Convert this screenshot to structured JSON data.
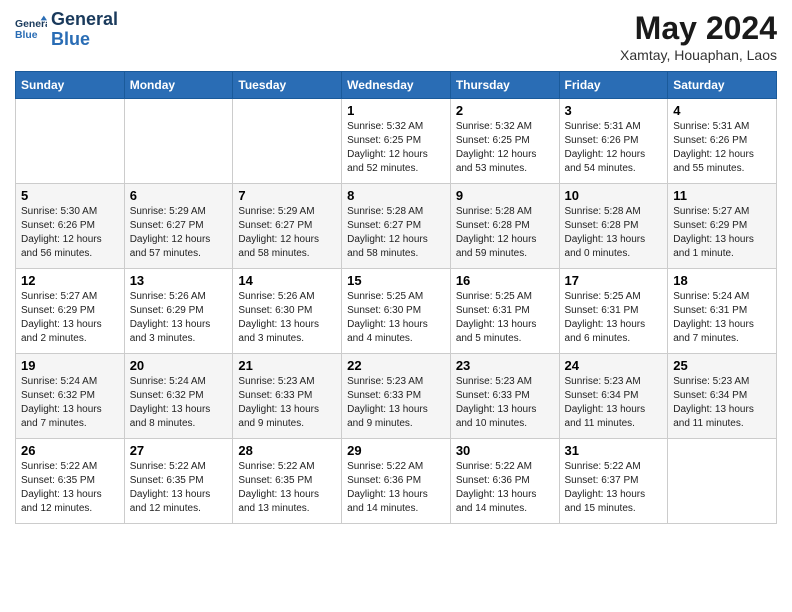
{
  "logo": {
    "line1": "General",
    "line2": "Blue"
  },
  "title": "May 2024",
  "location": "Xamtay, Houaphan, Laos",
  "weekdays": [
    "Sunday",
    "Monday",
    "Tuesday",
    "Wednesday",
    "Thursday",
    "Friday",
    "Saturday"
  ],
  "weeks": [
    [
      {
        "day": "",
        "info": ""
      },
      {
        "day": "",
        "info": ""
      },
      {
        "day": "",
        "info": ""
      },
      {
        "day": "1",
        "info": "Sunrise: 5:32 AM\nSunset: 6:25 PM\nDaylight: 12 hours\nand 52 minutes."
      },
      {
        "day": "2",
        "info": "Sunrise: 5:32 AM\nSunset: 6:25 PM\nDaylight: 12 hours\nand 53 minutes."
      },
      {
        "day": "3",
        "info": "Sunrise: 5:31 AM\nSunset: 6:26 PM\nDaylight: 12 hours\nand 54 minutes."
      },
      {
        "day": "4",
        "info": "Sunrise: 5:31 AM\nSunset: 6:26 PM\nDaylight: 12 hours\nand 55 minutes."
      }
    ],
    [
      {
        "day": "5",
        "info": "Sunrise: 5:30 AM\nSunset: 6:26 PM\nDaylight: 12 hours\nand 56 minutes."
      },
      {
        "day": "6",
        "info": "Sunrise: 5:29 AM\nSunset: 6:27 PM\nDaylight: 12 hours\nand 57 minutes."
      },
      {
        "day": "7",
        "info": "Sunrise: 5:29 AM\nSunset: 6:27 PM\nDaylight: 12 hours\nand 58 minutes."
      },
      {
        "day": "8",
        "info": "Sunrise: 5:28 AM\nSunset: 6:27 PM\nDaylight: 12 hours\nand 58 minutes."
      },
      {
        "day": "9",
        "info": "Sunrise: 5:28 AM\nSunset: 6:28 PM\nDaylight: 12 hours\nand 59 minutes."
      },
      {
        "day": "10",
        "info": "Sunrise: 5:28 AM\nSunset: 6:28 PM\nDaylight: 13 hours\nand 0 minutes."
      },
      {
        "day": "11",
        "info": "Sunrise: 5:27 AM\nSunset: 6:29 PM\nDaylight: 13 hours\nand 1 minute."
      }
    ],
    [
      {
        "day": "12",
        "info": "Sunrise: 5:27 AM\nSunset: 6:29 PM\nDaylight: 13 hours\nand 2 minutes."
      },
      {
        "day": "13",
        "info": "Sunrise: 5:26 AM\nSunset: 6:29 PM\nDaylight: 13 hours\nand 3 minutes."
      },
      {
        "day": "14",
        "info": "Sunrise: 5:26 AM\nSunset: 6:30 PM\nDaylight: 13 hours\nand 3 minutes."
      },
      {
        "day": "15",
        "info": "Sunrise: 5:25 AM\nSunset: 6:30 PM\nDaylight: 13 hours\nand 4 minutes."
      },
      {
        "day": "16",
        "info": "Sunrise: 5:25 AM\nSunset: 6:31 PM\nDaylight: 13 hours\nand 5 minutes."
      },
      {
        "day": "17",
        "info": "Sunrise: 5:25 AM\nSunset: 6:31 PM\nDaylight: 13 hours\nand 6 minutes."
      },
      {
        "day": "18",
        "info": "Sunrise: 5:24 AM\nSunset: 6:31 PM\nDaylight: 13 hours\nand 7 minutes."
      }
    ],
    [
      {
        "day": "19",
        "info": "Sunrise: 5:24 AM\nSunset: 6:32 PM\nDaylight: 13 hours\nand 7 minutes."
      },
      {
        "day": "20",
        "info": "Sunrise: 5:24 AM\nSunset: 6:32 PM\nDaylight: 13 hours\nand 8 minutes."
      },
      {
        "day": "21",
        "info": "Sunrise: 5:23 AM\nSunset: 6:33 PM\nDaylight: 13 hours\nand 9 minutes."
      },
      {
        "day": "22",
        "info": "Sunrise: 5:23 AM\nSunset: 6:33 PM\nDaylight: 13 hours\nand 9 minutes."
      },
      {
        "day": "23",
        "info": "Sunrise: 5:23 AM\nSunset: 6:33 PM\nDaylight: 13 hours\nand 10 minutes."
      },
      {
        "day": "24",
        "info": "Sunrise: 5:23 AM\nSunset: 6:34 PM\nDaylight: 13 hours\nand 11 minutes."
      },
      {
        "day": "25",
        "info": "Sunrise: 5:23 AM\nSunset: 6:34 PM\nDaylight: 13 hours\nand 11 minutes."
      }
    ],
    [
      {
        "day": "26",
        "info": "Sunrise: 5:22 AM\nSunset: 6:35 PM\nDaylight: 13 hours\nand 12 minutes."
      },
      {
        "day": "27",
        "info": "Sunrise: 5:22 AM\nSunset: 6:35 PM\nDaylight: 13 hours\nand 12 minutes."
      },
      {
        "day": "28",
        "info": "Sunrise: 5:22 AM\nSunset: 6:35 PM\nDaylight: 13 hours\nand 13 minutes."
      },
      {
        "day": "29",
        "info": "Sunrise: 5:22 AM\nSunset: 6:36 PM\nDaylight: 13 hours\nand 14 minutes."
      },
      {
        "day": "30",
        "info": "Sunrise: 5:22 AM\nSunset: 6:36 PM\nDaylight: 13 hours\nand 14 minutes."
      },
      {
        "day": "31",
        "info": "Sunrise: 5:22 AM\nSunset: 6:37 PM\nDaylight: 13 hours\nand 15 minutes."
      },
      {
        "day": "",
        "info": ""
      }
    ]
  ]
}
